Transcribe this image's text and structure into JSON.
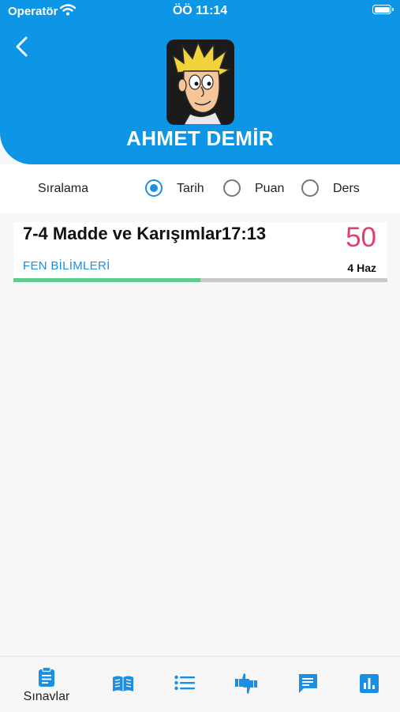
{
  "status_bar": {
    "carrier": "Operatör",
    "time": "ÖÖ 11:14"
  },
  "header": {
    "user_name": "AHMET DEMİR"
  },
  "sort": {
    "label": "Sıralama",
    "options": [
      {
        "label": "Tarih",
        "selected": true
      },
      {
        "label": "Puan",
        "selected": false
      },
      {
        "label": "Ders",
        "selected": false
      }
    ]
  },
  "exams": [
    {
      "title": "7-4 Madde ve Karışımlar17:13",
      "score": "50",
      "subject": "FEN BİLİMLERİ",
      "date": "4 Haz",
      "progress": 0.5
    }
  ],
  "tabs": [
    {
      "label": "Sınavlar",
      "icon": "clipboard-icon",
      "active": true
    },
    {
      "icon": "book-icon"
    },
    {
      "icon": "list-icon"
    },
    {
      "icon": "thumbs-icon"
    },
    {
      "icon": "chat-icon"
    },
    {
      "icon": "bar-chart-icon"
    }
  ],
  "colors": {
    "primary": "#0d96e6",
    "score": "#e1406d",
    "progress": "#5fcb8c",
    "accent": "#1a8fe3"
  }
}
